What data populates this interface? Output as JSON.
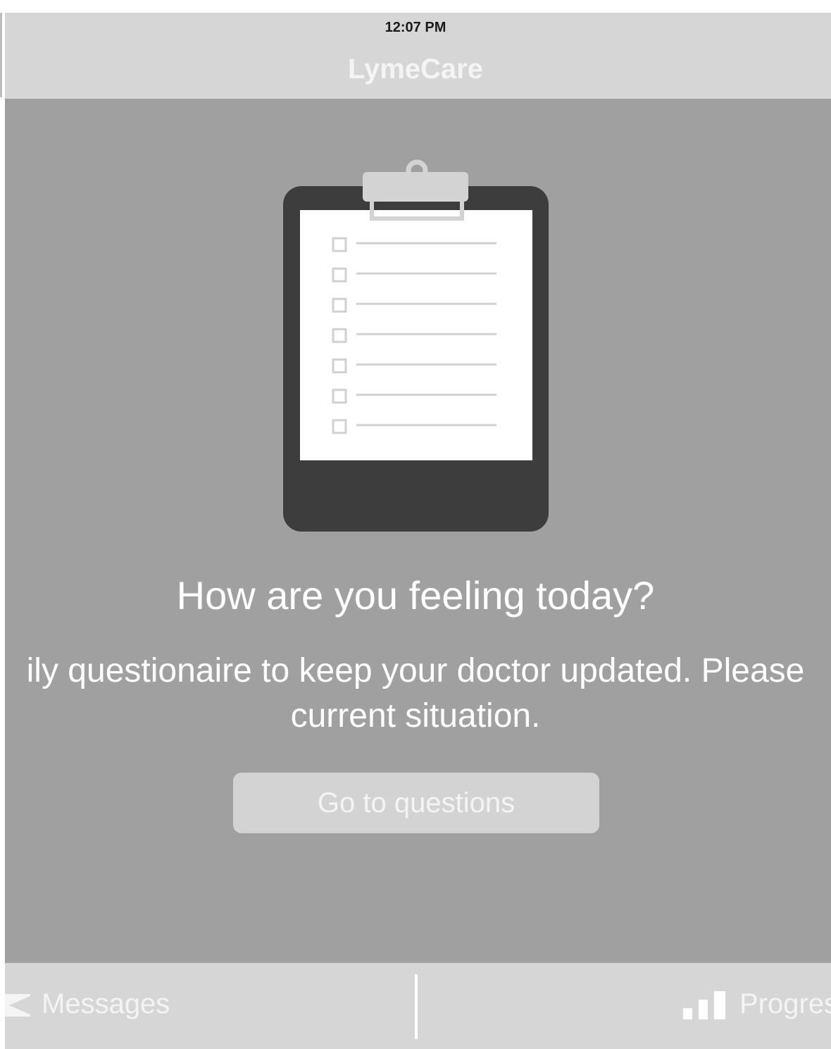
{
  "status_bar": {
    "time": "12:07 PM"
  },
  "header": {
    "title": "LymeCare"
  },
  "main": {
    "illustration_icon": "clipboard-checklist-icon",
    "heading": "How are you feeling today?",
    "description_line1": "ily questionaire to keep your doctor updated. Please",
    "description_line2": "current situation.",
    "cta_label": "Go to questions"
  },
  "tabbar": {
    "tabs": [
      {
        "label": "Messages",
        "icon": "envelope-icon"
      },
      {
        "label": "Progres",
        "icon": "bar-chart-icon"
      }
    ]
  },
  "colors": {
    "header_bg": "#d6d6d6",
    "main_bg": "#a0a0a0",
    "clipboard_board": "#3d3d3d",
    "button_bg": "#d3d3d3",
    "text_light": "#f4f4f4"
  }
}
